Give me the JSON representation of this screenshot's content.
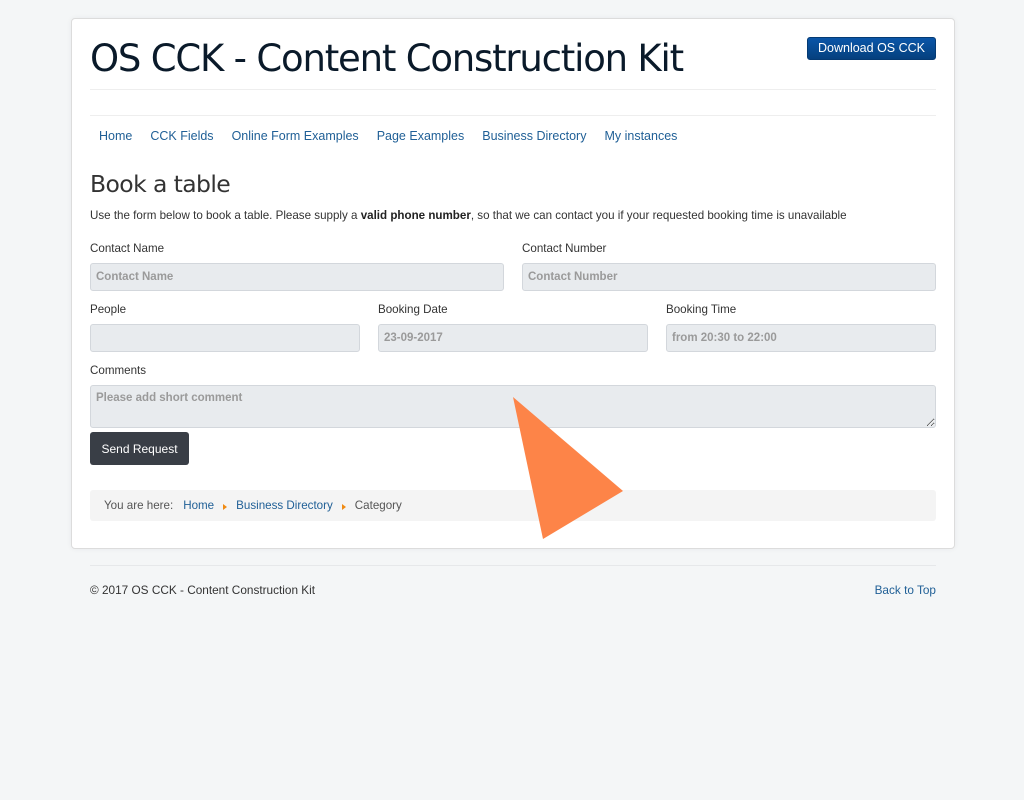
{
  "header": {
    "site_title": "OS CCK - Content Construction Kit",
    "download_button": "Download OS CCK"
  },
  "nav": {
    "items": [
      {
        "label": "Home"
      },
      {
        "label": "CCK Fields"
      },
      {
        "label": "Online Form Examples"
      },
      {
        "label": "Page Examples"
      },
      {
        "label": "Business Directory"
      },
      {
        "label": "My instances"
      }
    ]
  },
  "main": {
    "heading": "Book a table",
    "intro_before": "Use the form below to book a table. Please supply a ",
    "intro_bold": "valid phone number",
    "intro_after": ", so that we can contact you if your requested booking time is unavailable"
  },
  "form": {
    "contact_name": {
      "label": "Contact Name",
      "placeholder": "Contact Name",
      "value": ""
    },
    "contact_number": {
      "label": "Contact Number",
      "placeholder": "Contact Number",
      "value": ""
    },
    "people": {
      "label": "People",
      "placeholder": "",
      "value": ""
    },
    "booking_date": {
      "label": "Booking Date",
      "placeholder": "23-09-2017",
      "value": ""
    },
    "booking_time": {
      "label": "Booking Time",
      "placeholder": "from 20:30 to 22:00",
      "value": ""
    },
    "comments": {
      "label": "Comments",
      "placeholder": "Please add short comment",
      "value": ""
    },
    "submit_label": "Send Request"
  },
  "breadcrumb": {
    "label": "You are here:",
    "items": [
      {
        "label": "Home",
        "link": true
      },
      {
        "label": "Business Directory",
        "link": true
      },
      {
        "label": "Category",
        "link": false
      }
    ]
  },
  "footer": {
    "copyright": "© 2017 OS CCK - Content Construction Kit",
    "back_to_top": "Back to Top"
  },
  "colors": {
    "brand_blue": "#07488f",
    "link": "#1f5f96",
    "submit_button": "#393e46",
    "breadcrumb_separator": "#f08b13",
    "cursor_overlay": "#fd8448"
  }
}
